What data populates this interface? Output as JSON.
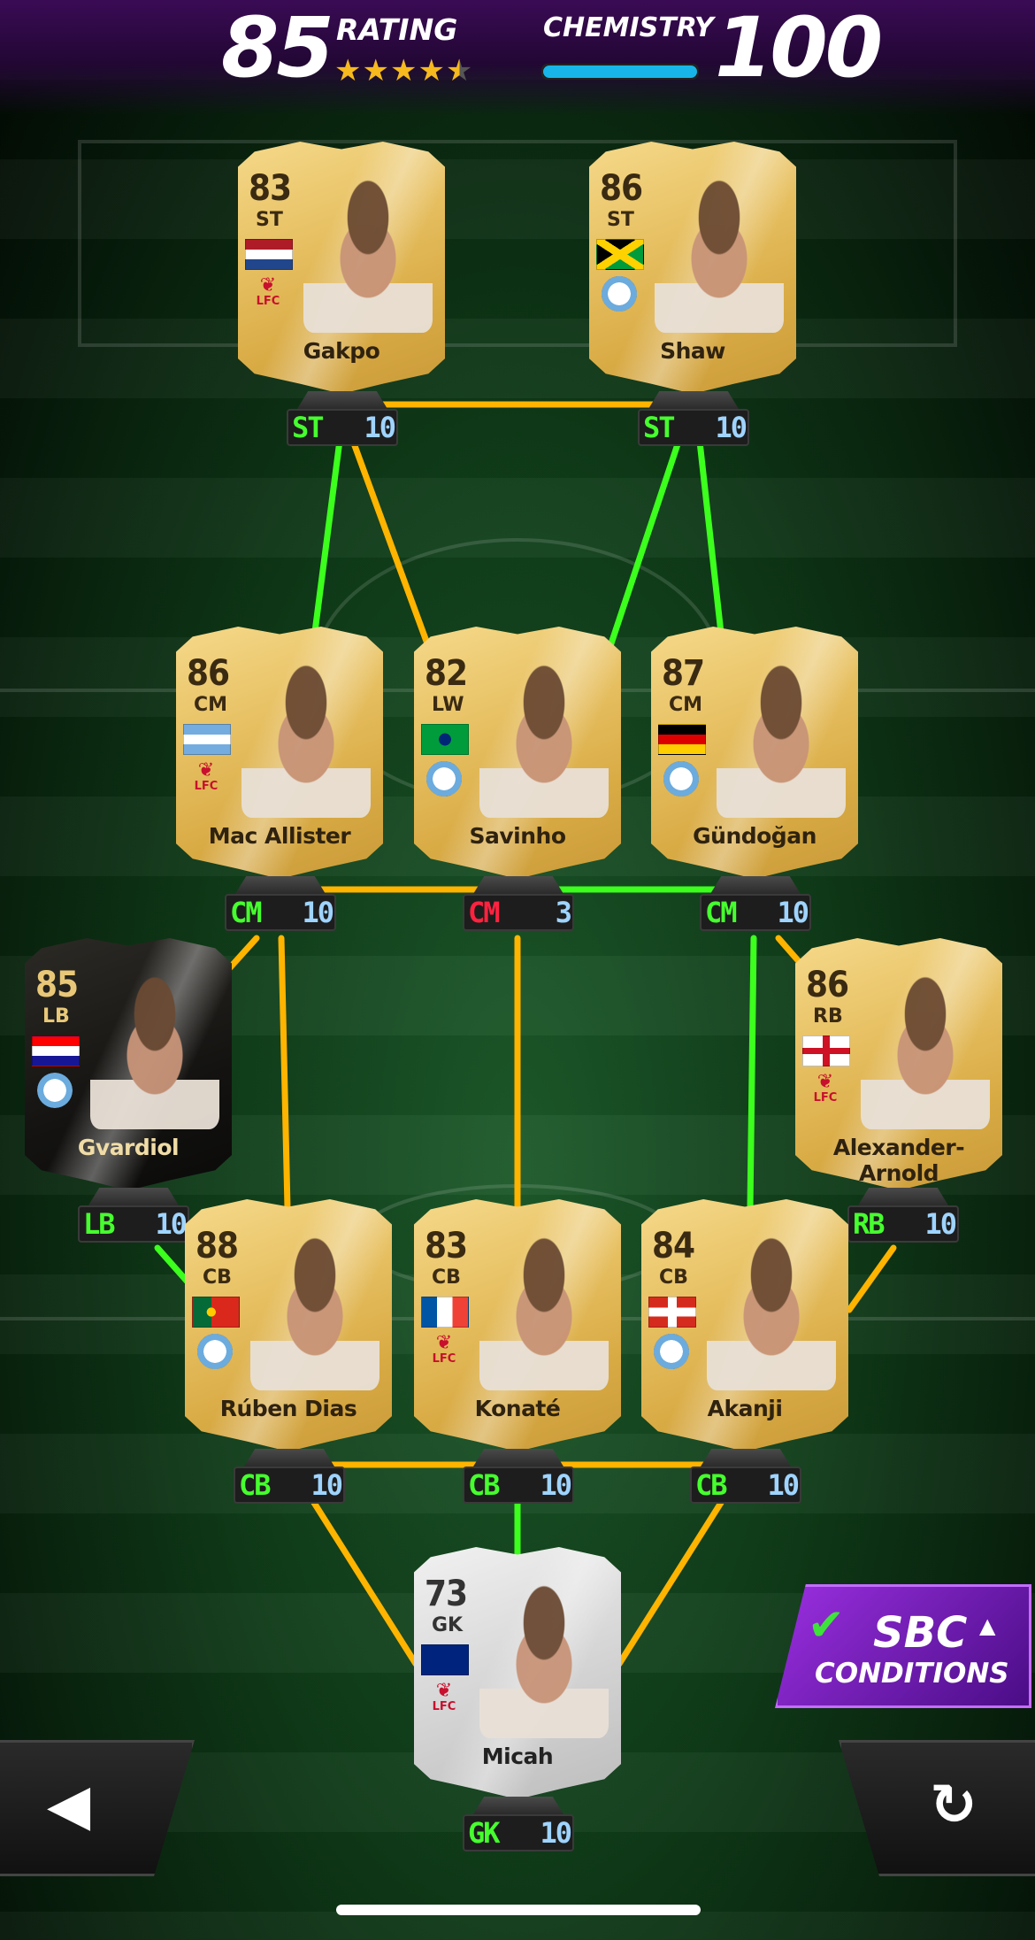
{
  "header": {
    "rating_value": "85",
    "rating_label": "RATING",
    "stars": "★★★★",
    "star_half": "★",
    "star_rating": 4.5,
    "chemistry_label": "CHEMISTRY",
    "chemistry_value": "100",
    "chemistry_fill": 1.0
  },
  "players": [
    {
      "name": "Gakpo",
      "rating": "83",
      "pos": "ST",
      "slot": "ST",
      "chem": "10",
      "card": "gold",
      "flag": "netherlands",
      "club": "lfc"
    },
    {
      "name": "Shaw",
      "rating": "86",
      "pos": "ST",
      "slot": "ST",
      "chem": "10",
      "card": "gold",
      "flag": "jamaica",
      "club": "mci"
    },
    {
      "name": "Mac Allister",
      "rating": "86",
      "pos": "CM",
      "slot": "CM",
      "chem": "10",
      "card": "gold",
      "flag": "argentina",
      "club": "lfc"
    },
    {
      "name": "Savinho",
      "rating": "82",
      "pos": "LW",
      "slot": "CM",
      "chem": "3",
      "card": "gold",
      "flag": "brazil",
      "club": "mci"
    },
    {
      "name": "Gündoğan",
      "rating": "87",
      "pos": "CM",
      "slot": "CM",
      "chem": "10",
      "card": "gold",
      "flag": "germany",
      "club": "mci"
    },
    {
      "name": "Gvardiol",
      "rating": "85",
      "pos": "LB",
      "slot": "LB",
      "chem": "10",
      "card": "special",
      "flag": "croatia",
      "club": "mci"
    },
    {
      "name": "Alexander-Arnold",
      "rating": "86",
      "pos": "RB",
      "slot": "RB",
      "chem": "10",
      "card": "gold",
      "flag": "england",
      "club": "lfc"
    },
    {
      "name": "Rúben Dias",
      "rating": "88",
      "pos": "CB",
      "slot": "CB",
      "chem": "10",
      "card": "gold",
      "flag": "portugal",
      "club": "mci"
    },
    {
      "name": "Konaté",
      "rating": "83",
      "pos": "CB",
      "slot": "CB",
      "chem": "10",
      "card": "gold",
      "flag": "france",
      "club": "lfc"
    },
    {
      "name": "Akanji",
      "rating": "84",
      "pos": "CB",
      "slot": "CB",
      "chem": "10",
      "card": "gold",
      "flag": "switzerland",
      "club": "mci"
    },
    {
      "name": "Micah",
      "rating": "73",
      "pos": "GK",
      "slot": "GK",
      "chem": "10",
      "card": "silver",
      "flag": "australia",
      "club": "lfc"
    }
  ],
  "club_labels": {
    "lfc": "LFC"
  },
  "sbc": {
    "line1": "SBC",
    "line2": "CONDITIONS"
  },
  "colors": {
    "link_green": "#3cff1e",
    "link_gold": "#ffb400",
    "accent_purple": "#8a2be2",
    "chem_bar": "#18b6e8"
  },
  "icons": {
    "back": "back-arrow-icon",
    "reset": "reset-icon",
    "check": "check-icon",
    "caret": "caret-up-icon"
  }
}
